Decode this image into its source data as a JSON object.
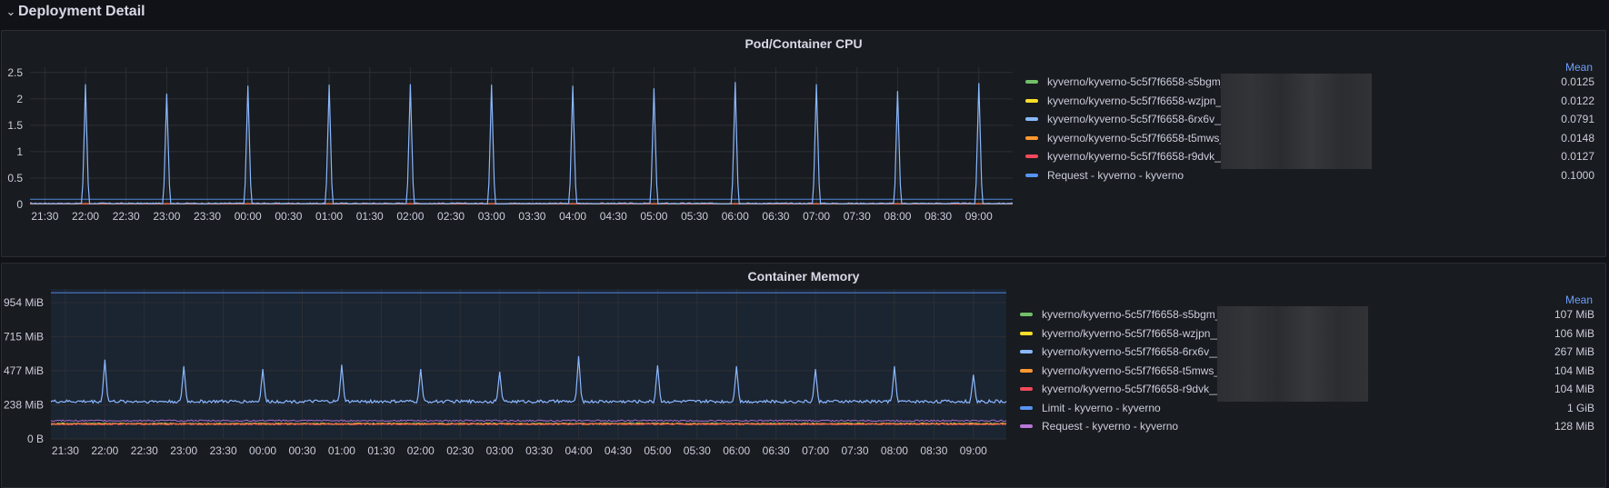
{
  "row": {
    "title": "Deployment Detail"
  },
  "colors": {
    "background": "#111217",
    "panel": "#181b1f",
    "s5bgm": "#73bf69",
    "wzjpn": "#fade2a",
    "6rx6v": "#8ab8ff",
    "t5mws": "#ff9830",
    "r9dvk": "#f2495c",
    "limit": "#5794f2",
    "request_cpu": "#5794f2",
    "request_mem": "#b877d9"
  },
  "cpu_panel": {
    "title": "Pod/Container CPU",
    "legend_header": "Mean",
    "legend": [
      {
        "name": "kyverno/kyverno-5c5f7f6658-s5bgm__on_",
        "value": "0.0125",
        "color": "#73bf69"
      },
      {
        "name": "kyverno/kyverno-5c5f7f6658-wzjpn__on_",
        "value": "0.0122",
        "color": "#fade2a"
      },
      {
        "name": "kyverno/kyverno-5c5f7f6658-6rx6v__on_",
        "value": "0.0791",
        "color": "#8ab8ff"
      },
      {
        "name": "kyverno/kyverno-5c5f7f6658-t5mws__on_",
        "value": "0.0148",
        "color": "#ff9830"
      },
      {
        "name": "kyverno/kyverno-5c5f7f6658-r9dvk__on_",
        "value": "0.0127",
        "color": "#f2495c"
      },
      {
        "name": "Request - kyverno - kyverno",
        "value": "0.1000",
        "color": "#5794f2"
      }
    ]
  },
  "mem_panel": {
    "title": "Container Memory",
    "legend_header": "Mean",
    "legend": [
      {
        "name": "kyverno/kyverno-5c5f7f6658-s5bgm__on_",
        "value": "107 MiB",
        "color": "#73bf69"
      },
      {
        "name": "kyverno/kyverno-5c5f7f6658-wzjpn__on_",
        "value": "106 MiB",
        "color": "#fade2a"
      },
      {
        "name": "kyverno/kyverno-5c5f7f6658-6rx6v__on_l",
        "value": "267 MiB",
        "color": "#8ab8ff"
      },
      {
        "name": "kyverno/kyverno-5c5f7f6658-t5mws__on_",
        "value": "104 MiB",
        "color": "#ff9830"
      },
      {
        "name": "kyverno/kyverno-5c5f7f6658-r9dvk__on_l",
        "value": "104 MiB",
        "color": "#f2495c"
      },
      {
        "name": "Limit - kyverno - kyverno",
        "value": "1 GiB",
        "color": "#5794f2"
      },
      {
        "name": "Request - kyverno - kyverno",
        "value": "128 MiB",
        "color": "#b877d9"
      }
    ]
  },
  "chart_data": [
    {
      "type": "line",
      "title": "Pod/Container CPU",
      "x_ticks": [
        "21:30",
        "22:00",
        "22:30",
        "23:00",
        "23:30",
        "00:00",
        "00:30",
        "01:00",
        "01:30",
        "02:00",
        "02:30",
        "03:00",
        "03:30",
        "04:00",
        "04:30",
        "05:00",
        "05:30",
        "06:00",
        "06:30",
        "07:00",
        "07:30",
        "08:00",
        "08:30",
        "09:00"
      ],
      "y_ticks": [
        "0",
        "0.5",
        "1",
        "1.5",
        "2",
        "2.5"
      ],
      "y_tick_values": [
        0,
        0.5,
        1,
        1.5,
        2,
        2.5
      ],
      "ylim": [
        0,
        2.6
      ],
      "xlim": [
        "21:19",
        "09:25"
      ],
      "grid": true,
      "legend_position": "right",
      "series": [
        {
          "name": "kyverno/kyverno-5c5f7f6658-6rx6v__on_",
          "color": "#8ab8ff",
          "baseline": 0.02,
          "spikes": [
            {
              "x": "22:00",
              "y": 2.28
            },
            {
              "x": "23:00",
              "y": 2.1
            },
            {
              "x": "00:00",
              "y": 2.25
            },
            {
              "x": "01:00",
              "y": 2.27
            },
            {
              "x": "02:00",
              "y": 2.28
            },
            {
              "x": "03:00",
              "y": 2.27
            },
            {
              "x": "04:00",
              "y": 2.25
            },
            {
              "x": "05:00",
              "y": 2.2
            },
            {
              "x": "06:00",
              "y": 2.32
            },
            {
              "x": "07:00",
              "y": 2.28
            },
            {
              "x": "08:00",
              "y": 2.15
            },
            {
              "x": "09:00",
              "y": 2.3
            }
          ]
        },
        {
          "name": "kyverno/kyverno-5c5f7f6658-s5bgm__on_",
          "color": "#73bf69",
          "baseline": 0.012
        },
        {
          "name": "kyverno/kyverno-5c5f7f6658-wzjpn__on_",
          "color": "#fade2a",
          "baseline": 0.012
        },
        {
          "name": "kyverno/kyverno-5c5f7f6658-t5mws__on_",
          "color": "#ff9830",
          "baseline": 0.015
        },
        {
          "name": "kyverno/kyverno-5c5f7f6658-r9dvk__on_",
          "color": "#f2495c",
          "baseline": 0.013
        },
        {
          "name": "Request - kyverno - kyverno",
          "color": "#5794f2",
          "baseline": 0.1
        }
      ]
    },
    {
      "type": "line",
      "title": "Container Memory",
      "x_ticks": [
        "21:30",
        "22:00",
        "22:30",
        "23:00",
        "23:30",
        "00:00",
        "00:30",
        "01:00",
        "01:30",
        "02:00",
        "02:30",
        "03:00",
        "03:30",
        "04:00",
        "04:30",
        "05:00",
        "05:30",
        "06:00",
        "06:30",
        "07:00",
        "07:30",
        "08:00",
        "08:30",
        "09:00"
      ],
      "y_ticks": [
        "0 B",
        "238 MiB",
        "477 MiB",
        "715 MiB",
        "954 MiB"
      ],
      "y_tick_values": [
        0,
        238,
        477,
        715,
        954
      ],
      "ylim": [
        0,
        1050
      ],
      "xlim": [
        "21:19",
        "09:25"
      ],
      "grid": true,
      "legend_position": "right",
      "series": [
        {
          "name": "kyverno/kyverno-5c5f7f6658-6rx6v__on_l",
          "color": "#8ab8ff",
          "baseline": 262,
          "spikes": [
            {
              "x": "22:00",
              "y": 555
            },
            {
              "x": "23:00",
              "y": 510
            },
            {
              "x": "00:00",
              "y": 490
            },
            {
              "x": "01:00",
              "y": 520
            },
            {
              "x": "02:00",
              "y": 490
            },
            {
              "x": "03:00",
              "y": 470
            },
            {
              "x": "04:00",
              "y": 580
            },
            {
              "x": "05:00",
              "y": 515
            },
            {
              "x": "06:00",
              "y": 510
            },
            {
              "x": "07:00",
              "y": 490
            },
            {
              "x": "08:00",
              "y": 510
            },
            {
              "x": "09:00",
              "y": 450
            }
          ]
        },
        {
          "name": "kyverno/kyverno-5c5f7f6658-s5bgm__on_",
          "color": "#73bf69",
          "baseline": 107
        },
        {
          "name": "kyverno/kyverno-5c5f7f6658-wzjpn__on_",
          "color": "#fade2a",
          "baseline": 106
        },
        {
          "name": "kyverno/kyverno-5c5f7f6658-t5mws__on_",
          "color": "#ff9830",
          "baseline": 104
        },
        {
          "name": "kyverno/kyverno-5c5f7f6658-r9dvk__on_l",
          "color": "#f2495c",
          "baseline": 104
        },
        {
          "name": "Limit - kyverno - kyverno",
          "color": "#5794f2",
          "baseline": 1024
        },
        {
          "name": "Request - kyverno - kyverno",
          "color": "#b877d9",
          "baseline": 128
        }
      ]
    }
  ]
}
